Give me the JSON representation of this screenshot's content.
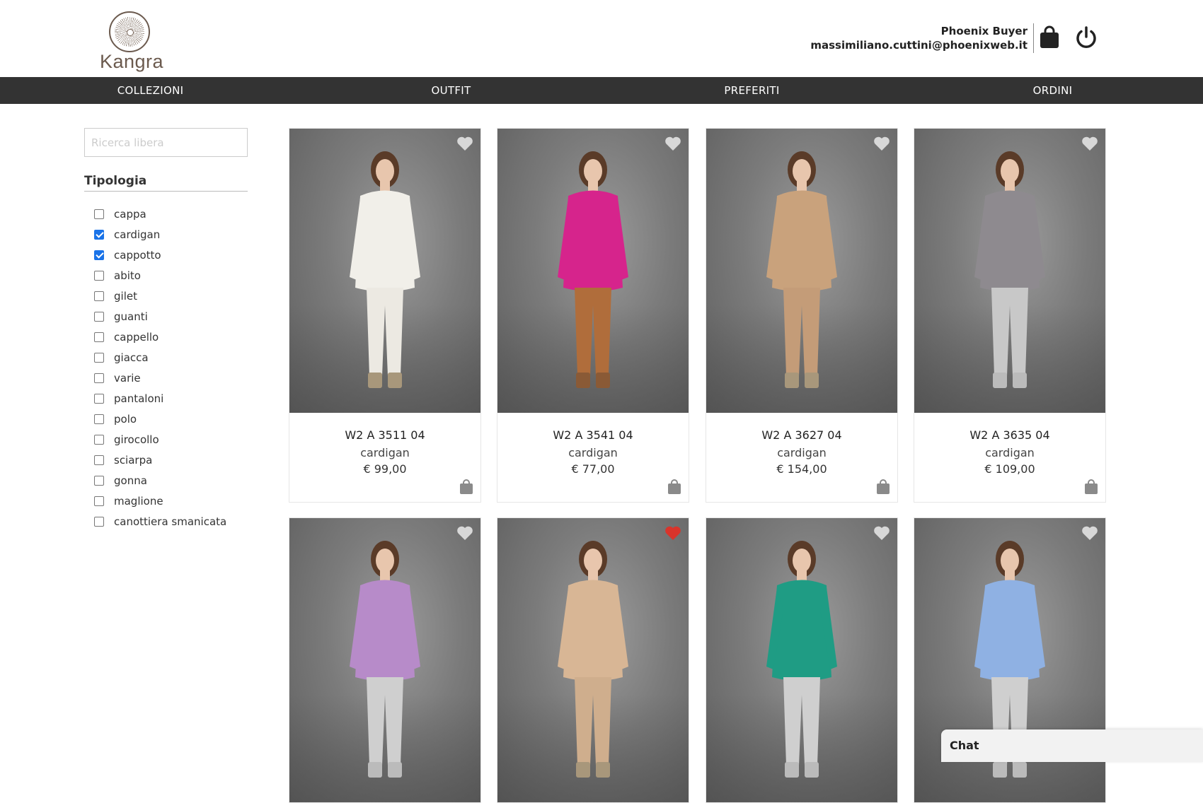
{
  "brand": {
    "logo_text": "Kangra"
  },
  "user": {
    "role": "Phoenix Buyer",
    "email": "massimiliano.cuttini@phoenixweb.it"
  },
  "header_icons": [
    "shopping-bag-icon",
    "power-icon"
  ],
  "nav": {
    "items": [
      {
        "label": "COLLEZIONI"
      },
      {
        "label": "OUTFIT"
      },
      {
        "label": "PREFERITI"
      },
      {
        "label": "ORDINI"
      }
    ]
  },
  "search": {
    "placeholder": "Ricerca libera",
    "value": ""
  },
  "filters": {
    "title": "Tipologia",
    "items": [
      {
        "label": "cappa",
        "checked": false
      },
      {
        "label": "cardigan",
        "checked": true
      },
      {
        "label": "cappotto",
        "checked": true
      },
      {
        "label": "abito",
        "checked": false
      },
      {
        "label": "gilet",
        "checked": false
      },
      {
        "label": "guanti",
        "checked": false
      },
      {
        "label": "cappello",
        "checked": false
      },
      {
        "label": "giacca",
        "checked": false
      },
      {
        "label": "varie",
        "checked": false
      },
      {
        "label": "pantaloni",
        "checked": false
      },
      {
        "label": "polo",
        "checked": false
      },
      {
        "label": "girocollo",
        "checked": false
      },
      {
        "label": "sciarpa",
        "checked": false
      },
      {
        "label": "gonna",
        "checked": false
      },
      {
        "label": "maglione",
        "checked": false
      },
      {
        "label": "canottiera smanicata",
        "checked": false
      }
    ]
  },
  "products": [
    {
      "code": "W2 A 3511 04",
      "type": "cardigan",
      "price": "€ 99,00",
      "favorite": false,
      "top_color": "#f1efe9",
      "bottom_color": "#ece9e2",
      "shoe_color": "#a8977b"
    },
    {
      "code": "W2 A 3541 04",
      "type": "cardigan",
      "price": "€ 77,00",
      "favorite": false,
      "top_color": "#d6248c",
      "bottom_color": "#b06d3b",
      "shoe_color": "#8a5a36"
    },
    {
      "code": "W2 A 3627 04",
      "type": "cardigan",
      "price": "€ 154,00",
      "favorite": false,
      "top_color": "#c9a27c",
      "bottom_color": "#c49c78",
      "shoe_color": "#a8977b"
    },
    {
      "code": "W2 A 3635 04",
      "type": "cardigan",
      "price": "€ 109,00",
      "favorite": false,
      "top_color": "#8e8a8f",
      "bottom_color": "#c8c8c8",
      "shoe_color": "#bbbbbb"
    },
    {
      "favorite": false,
      "top_color": "#b78bc9",
      "bottom_color": "#cfcfcf",
      "shoe_color": "#bbbbbb"
    },
    {
      "favorite": true,
      "top_color": "#d8b695",
      "bottom_color": "#cfae8d",
      "shoe_color": "#a8977b"
    },
    {
      "favorite": false,
      "top_color": "#1f9c84",
      "bottom_color": "#cfcfcf",
      "shoe_color": "#bbbbbb"
    },
    {
      "favorite": false,
      "top_color": "#8fb1e3",
      "bottom_color": "#cfcfcf",
      "shoe_color": "#bbbbbb"
    }
  ],
  "colors": {
    "favorite_on": "#d9342b",
    "favorite_off": "#d8d8d8",
    "nav_bg": "#333333",
    "checkbox_on": "#1a73e8"
  },
  "chat": {
    "label": "Chat"
  }
}
